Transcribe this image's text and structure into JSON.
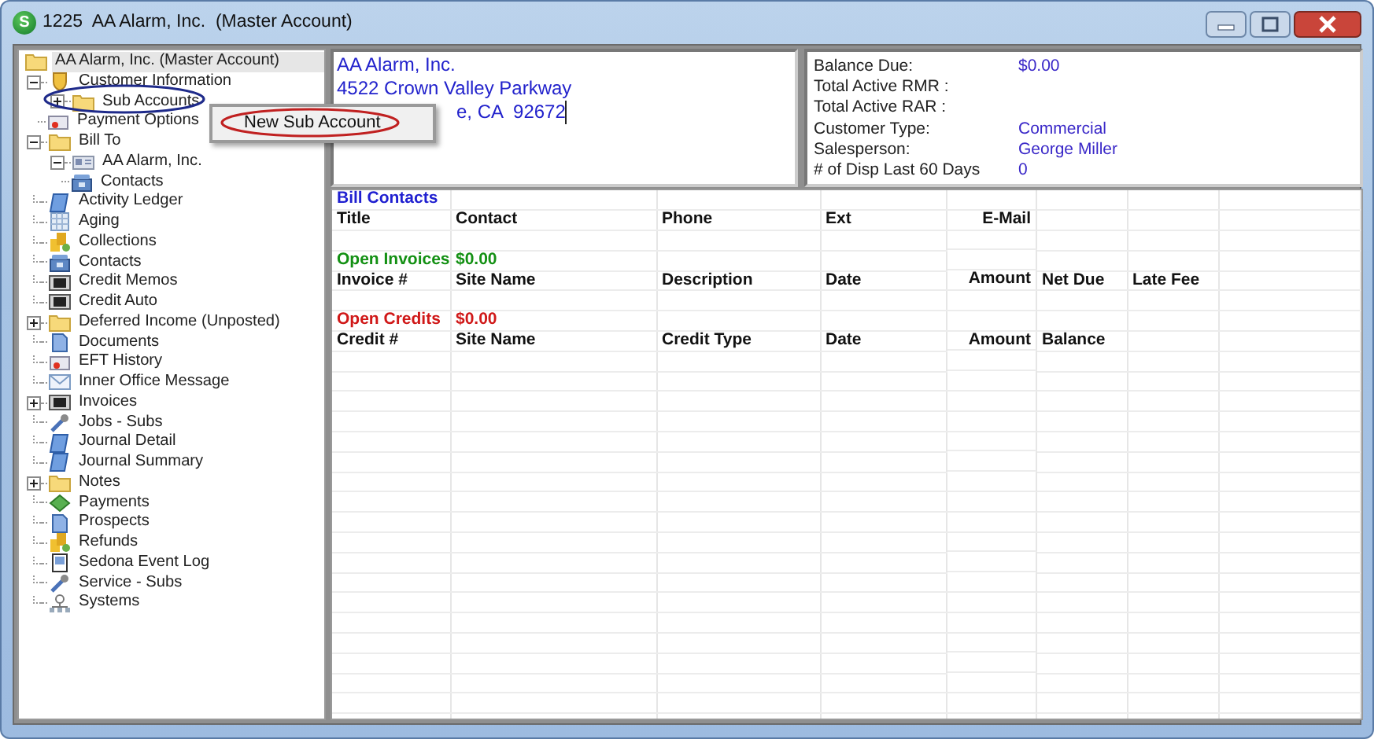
{
  "window": {
    "icon_letter": "S",
    "title": "1225  AA Alarm, Inc.  (Master Account)"
  },
  "tree": {
    "items": [
      {
        "label": "AA Alarm, Inc. (Master Account)",
        "selected": true,
        "children": [
          {
            "label": "Customer Information",
            "selected": false,
            "expanded": true,
            "children": [
              {
                "label": "Sub Accounts",
                "selected": false,
                "expanded": false
              },
              {
                "label": "Payment Options",
                "selected": false
              }
            ]
          },
          {
            "label": "Bill To",
            "selected": false,
            "expanded": true,
            "children": [
              {
                "label": "AA Alarm, Inc.",
                "selected": false,
                "expanded": true,
                "children": [
                  {
                    "label": "Contacts",
                    "selected": false
                  }
                ]
              }
            ]
          },
          {
            "label": "Activity Ledger",
            "selected": false
          },
          {
            "label": "Aging",
            "selected": false
          },
          {
            "label": "Collections",
            "selected": false
          },
          {
            "label": "Contacts",
            "selected": false
          },
          {
            "label": "Credit Memos",
            "selected": false
          },
          {
            "label": "Credit Auto",
            "selected": false
          },
          {
            "label": "Deferred Income (Unposted)",
            "selected": false,
            "expanded": false
          },
          {
            "label": "Documents",
            "selected": false
          },
          {
            "label": "EFT History",
            "selected": false
          },
          {
            "label": "Inner Office Message",
            "selected": false
          },
          {
            "label": "Invoices",
            "selected": false,
            "expanded": false
          },
          {
            "label": "Jobs - Subs",
            "selected": false
          },
          {
            "label": "Journal Detail",
            "selected": false
          },
          {
            "label": "Journal Summary",
            "selected": false
          },
          {
            "label": "Notes",
            "selected": false,
            "expanded": false
          },
          {
            "label": "Payments",
            "selected": false
          },
          {
            "label": "Prospects",
            "selected": false
          },
          {
            "label": "Refunds",
            "selected": false
          },
          {
            "label": "Sedona Event Log",
            "selected": false
          },
          {
            "label": "Service - Subs",
            "selected": false
          },
          {
            "label": "Systems",
            "selected": false
          }
        ]
      }
    ]
  },
  "context_menu": {
    "items": [
      "New Sub Account"
    ]
  },
  "address": {
    "lines": [
      "AA Alarm, Inc.",
      "4522 Crown Valley Parkway",
      "e, CA  92672"
    ]
  },
  "summary": [
    {
      "label": "Balance Due:",
      "value": "$0.00"
    },
    {
      "label": "Total Active RMR :"
    },
    {
      "label": "Total Active RAR :"
    },
    {
      "label": "Customer Type:",
      "value": "Commercial"
    },
    {
      "label": "Salesperson:",
      "value": "George Miller"
    },
    {
      "label": "# of Disp Last 60 Days",
      "value": "0"
    }
  ],
  "grid": {
    "sections": [
      {
        "title": "Bill Contacts",
        "color": "#1f1fd0",
        "columns": [
          "Title",
          "Contact",
          "Phone",
          "Ext",
          "E-Mail"
        ]
      },
      {
        "title": "Open Invoices",
        "total": "$0.00",
        "color": "#139013",
        "columns": [
          "Invoice #",
          "Site Name",
          "Description",
          "Date",
          "Amount",
          "Net Due",
          "Late Fee"
        ]
      },
      {
        "title": "Open Credits",
        "total": "$0.00",
        "color": "#d01818",
        "columns": [
          "Credit #",
          "Site Name",
          "Credit Type",
          "Date",
          "Amount",
          "Balance"
        ]
      }
    ]
  }
}
